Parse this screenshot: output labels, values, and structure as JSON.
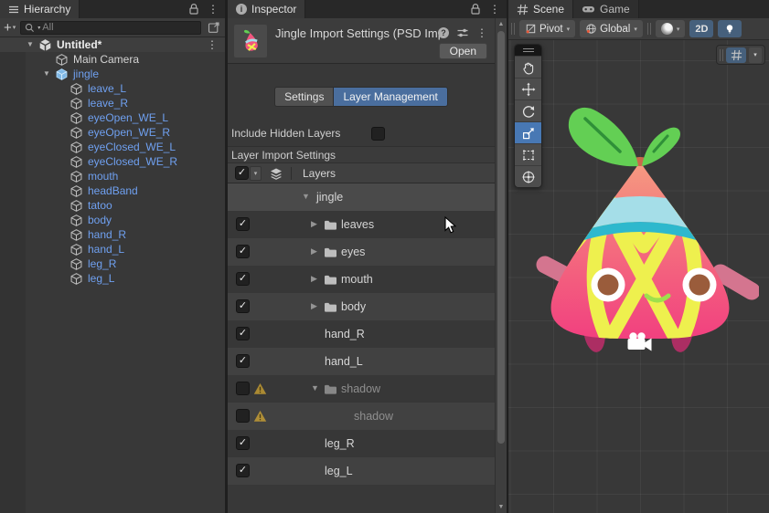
{
  "hierarchy": {
    "tab_label": "Hierarchy",
    "search_placeholder": "All",
    "scene_row_label": "Untitled*",
    "items": [
      {
        "label": "Main Camera",
        "kind": "gameobject"
      },
      {
        "label": "jingle",
        "kind": "prefab-root",
        "expanded": true
      },
      {
        "label": "leave_L",
        "kind": "prefab-child"
      },
      {
        "label": "leave_R",
        "kind": "prefab-child"
      },
      {
        "label": "eyeOpen_WE_L",
        "kind": "prefab-child"
      },
      {
        "label": "eyeOpen_WE_R",
        "kind": "prefab-child"
      },
      {
        "label": "eyeClosed_WE_L",
        "kind": "prefab-child"
      },
      {
        "label": "eyeClosed_WE_R",
        "kind": "prefab-child"
      },
      {
        "label": "mouth",
        "kind": "prefab-child"
      },
      {
        "label": "headBand",
        "kind": "prefab-child"
      },
      {
        "label": "tatoo",
        "kind": "prefab-child"
      },
      {
        "label": "body",
        "kind": "prefab-child"
      },
      {
        "label": "hand_R",
        "kind": "prefab-child"
      },
      {
        "label": "hand_L",
        "kind": "prefab-child"
      },
      {
        "label": "leg_R",
        "kind": "prefab-child"
      },
      {
        "label": "leg_L",
        "kind": "prefab-child"
      }
    ]
  },
  "inspector": {
    "tab_label": "Inspector",
    "title": "Jingle Import Settings (PSD Imp",
    "open_button_label": "Open",
    "mode_tabs": {
      "settings": "Settings",
      "layer_management": "Layer Management",
      "active": "Layer Management"
    },
    "include_hidden_layers_label": "Include Hidden Layers",
    "include_hidden_layers_checked": false,
    "section_title": "Layer Import Settings",
    "table_header_label": "Layers",
    "layers": [
      {
        "name": "jingle",
        "row": "root",
        "expanded": true
      },
      {
        "name": "leaves",
        "row": "group",
        "checked": true
      },
      {
        "name": "eyes",
        "row": "group",
        "checked": true
      },
      {
        "name": "mouth",
        "row": "group",
        "checked": true
      },
      {
        "name": "body",
        "row": "group",
        "checked": true
      },
      {
        "name": "hand_R",
        "row": "layer",
        "checked": true
      },
      {
        "name": "hand_L",
        "row": "layer",
        "checked": true
      },
      {
        "name": "shadow",
        "row": "group",
        "checked": false,
        "warning": true,
        "expanded": true
      },
      {
        "name": "shadow",
        "row": "child-layer",
        "checked": false,
        "warning": true
      },
      {
        "name": "leg_R",
        "row": "layer",
        "checked": true
      },
      {
        "name": "leg_L",
        "row": "layer",
        "checked": true
      }
    ]
  },
  "scene_view": {
    "tab_scene": "Scene",
    "tab_game": "Game",
    "toolbar": {
      "pivot_label": "Pivot",
      "global_label": "Global",
      "mode_2d_label": "2D"
    },
    "tools": [
      "hand-tool",
      "move-tool",
      "rotate-tool",
      "scale-tool (selected)",
      "rect-tool",
      "transform-tool"
    ],
    "overlays": [
      "grid-visibility-toggle"
    ]
  },
  "icons": {
    "hierarchy_tab": "menu-icon",
    "inspector_tab": "info-icon",
    "scene_tab": "grid-icon",
    "game_tab": "gamepad-icon",
    "search": "search-icon",
    "lock": "lock-icon",
    "more": "kebab-menu-icon",
    "create": "plus-icon",
    "popout": "open-window-icon",
    "scene_asset": "unity-scene-icon",
    "gameobject": "cube-icon",
    "prefab": "prefab-cube-icon",
    "help": "help-icon",
    "presets": "presets-icon",
    "folder": "folder-icon",
    "warning": "warning-icon",
    "layers_stack": "layers-stack-icon",
    "pivot": "pivot-icon",
    "global": "globe-icon",
    "shading": "shaded-sphere-icon",
    "light": "light-bulb-icon",
    "camera_gizmo": "camera-gizmo-icon",
    "cursor": "mouse-cursor"
  },
  "colors": {
    "selection_blue": "#4A6E9E",
    "toolbar_active_blue": "#46607C",
    "tool_selected_blue": "#4878B4",
    "prefab_text_blue": "#6FA0F0",
    "warning_yellow": "#F8C231",
    "character": {
      "body_top": "#F59B80",
      "body_bottom": "#F2407F",
      "leaf_green": "#63CF54",
      "leaf_vein": "#2F9038",
      "stripe_yellow": "#EEF04E",
      "band_blue": "#A5DEE8",
      "band_teal": "#2EB8CD",
      "arm_pink": "#D4758F",
      "leg_magenta": "#AC2E63",
      "eye_brown": "#9A5C3B",
      "smile_green": "#9EE04C"
    }
  }
}
